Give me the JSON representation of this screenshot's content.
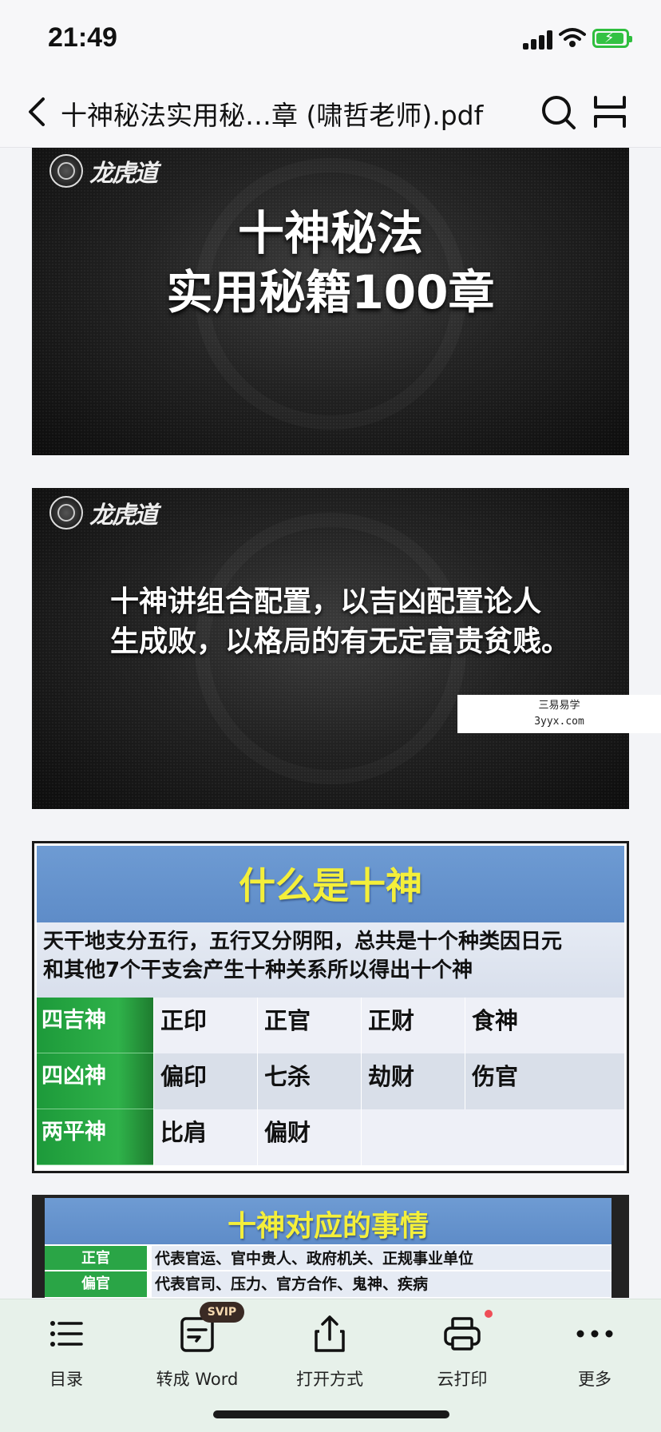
{
  "status_bar": {
    "time": "21:49"
  },
  "header": {
    "title": "十神秘法实用秘…章 (啸哲老师).pdf"
  },
  "pages": {
    "cover": {
      "logo_text": "龙虎道",
      "title_line1": "十神秘法",
      "title_line2": "实用秘籍100章"
    },
    "intro": {
      "logo_text": "龙虎道",
      "line1": "十神讲组合配置，以吉凶配置论人",
      "line2": "生成败，以格局的有无定富贵贫贱。"
    },
    "sticker": {
      "line1": "三易易学",
      "line2": "3yyx.com"
    },
    "what_is": {
      "heading": "什么是十神",
      "desc_line1": "天干地支分五行，五行又分阴阳，总共是十个种类因日元",
      "desc_line2": "和其他7个干支会产生十种关系所以得出十个神",
      "rows": [
        {
          "label": "四吉神",
          "cells": [
            "正印",
            "正官",
            "正财",
            "食神"
          ]
        },
        {
          "label": "四凶神",
          "cells": [
            "偏印",
            "七杀",
            "劫财",
            "伤官"
          ]
        },
        {
          "label": "两平神",
          "cells": [
            "比肩",
            "偏财",
            "",
            ""
          ]
        }
      ]
    },
    "matters": {
      "heading": "十神对应的事情",
      "rows": [
        {
          "key": "正官",
          "value": "代表官运、官中贵人、政府机关、正规事业单位"
        },
        {
          "key": "偏官",
          "value": "代表官司、压力、官方合作、鬼神、疾病"
        }
      ]
    }
  },
  "toolbar": {
    "items": [
      {
        "label": "目录",
        "icon": "list-icon"
      },
      {
        "label": "转成 Word",
        "icon": "convert-word-icon",
        "badge": "SVIP"
      },
      {
        "label": "打开方式",
        "icon": "share-icon"
      },
      {
        "label": "云打印",
        "icon": "printer-icon"
      },
      {
        "label": "更多",
        "icon": "more-icon"
      }
    ]
  },
  "colors": {
    "accent_green": "#2aa546",
    "header_blue": "#6e9bd3",
    "title_yellow": "#f4ef3a",
    "battery_green": "#33c243"
  }
}
